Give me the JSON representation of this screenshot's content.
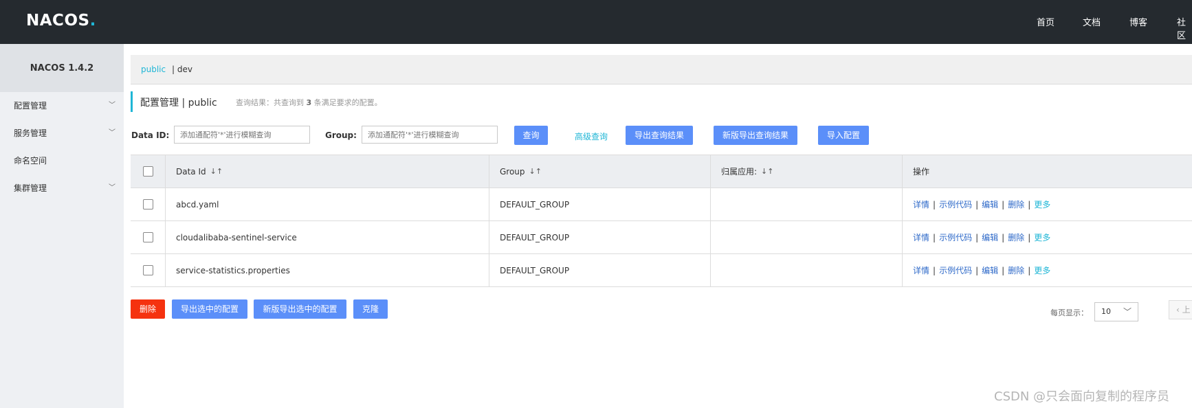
{
  "header": {
    "logo": {
      "part1": "NAC",
      "part2": "OS",
      "dot": "."
    },
    "nav": [
      "首页",
      "文档",
      "博客",
      "社区"
    ]
  },
  "sidebar": {
    "title": "NACOS 1.4.2",
    "items": [
      {
        "label": "配置管理",
        "has_chevron": true
      },
      {
        "label": "服务管理",
        "has_chevron": true
      },
      {
        "label": "命名空间",
        "has_chevron": false
      },
      {
        "label": "集群管理",
        "has_chevron": true
      }
    ]
  },
  "namespace": {
    "active": "public",
    "separator": "|",
    "other": "dev"
  },
  "title": {
    "main": "配置管理",
    "separator": "|",
    "namespace": "public",
    "result_prefix": "查询结果：共查询到",
    "result_count": "3",
    "result_suffix": "条满足要求的配置。"
  },
  "search": {
    "data_id_label": "Data ID:",
    "data_id_placeholder": "添加通配符'*'进行模糊查询",
    "group_label": "Group:",
    "group_placeholder": "添加通配符'*'进行模糊查询",
    "query_button": "查询",
    "advanced_link": "高级查询",
    "export_button": "导出查询结果",
    "new_export_button": "新版导出查询结果",
    "import_button": "导入配置"
  },
  "table": {
    "columns": [
      "Data Id",
      "Group",
      "归属应用:",
      "操作"
    ],
    "sort_icon": "↓↑",
    "rows": [
      {
        "data_id": "abcd.yaml",
        "group": "DEFAULT_GROUP",
        "app": ""
      },
      {
        "data_id": "cloudalibaba-sentinel-service",
        "group": "DEFAULT_GROUP",
        "app": ""
      },
      {
        "data_id": "service-statistics.properties",
        "group": "DEFAULT_GROUP",
        "app": ""
      }
    ],
    "operations": [
      "详情",
      "示例代码",
      "编辑",
      "删除",
      "更多"
    ]
  },
  "bulk": {
    "delete_button": "删除",
    "export_selected_button": "导出选中的配置",
    "new_export_selected_button": "新版导出选中的配置",
    "clone_button": "克隆"
  },
  "pagination": {
    "page_size_label": "每页显示：",
    "page_size": "10",
    "prev_label": "上"
  },
  "watermark": "CSDN @只会面向复制的程序员",
  "colors": {
    "accent": "#1fb6d6",
    "primary_button": "#5b8ff9",
    "danger_button": "#f5320f",
    "header_bg": "#252a2f"
  }
}
